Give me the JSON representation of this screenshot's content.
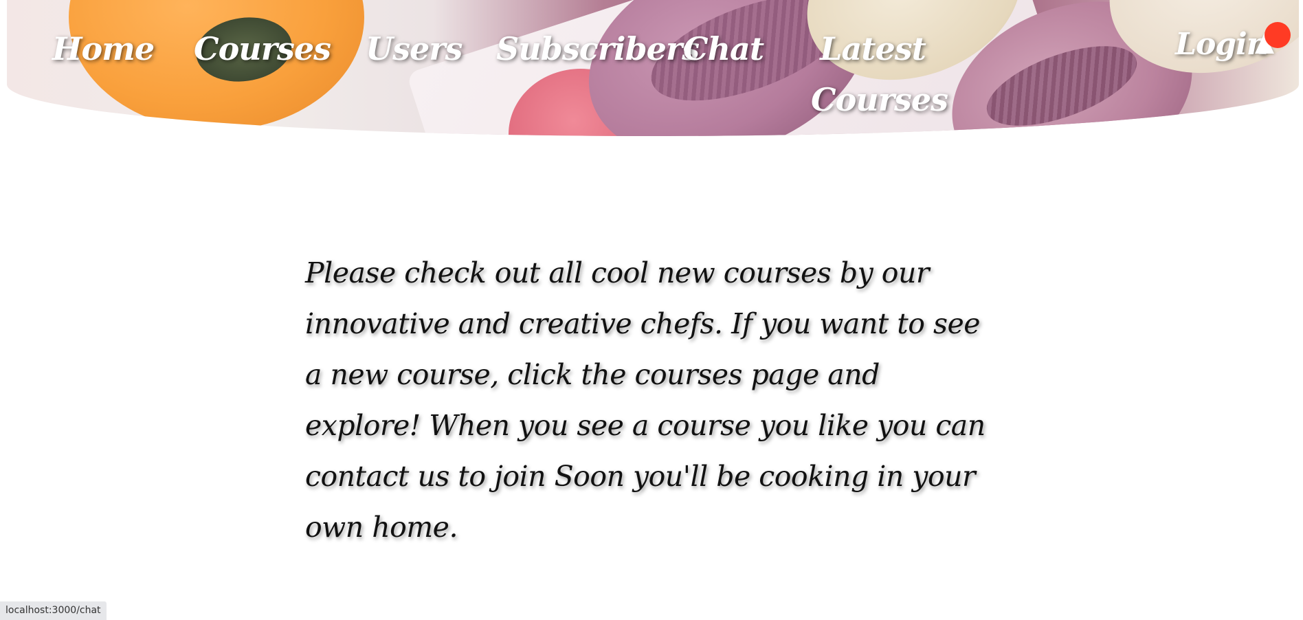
{
  "nav": {
    "home": "Home",
    "courses": "Courses",
    "users": "Users",
    "subscribers": "Subscribers",
    "chat": "Chat",
    "latest_courses": "Latest Courses",
    "login": "Login",
    "notification_icon": "bell-icon"
  },
  "main": {
    "intro_text": "Please check out all cool new courses by our innovative and creative chefs. If you want to see a new course, click the courses page and explore! When you see a course you like you can contact us to join Soon you'll be cooking in your own home."
  },
  "status_bar": {
    "url": "localhost:3000/chat"
  },
  "colors": {
    "notification_dot": "#ff3b24",
    "nav_text": "#ffffff",
    "body_text": "#111111"
  }
}
